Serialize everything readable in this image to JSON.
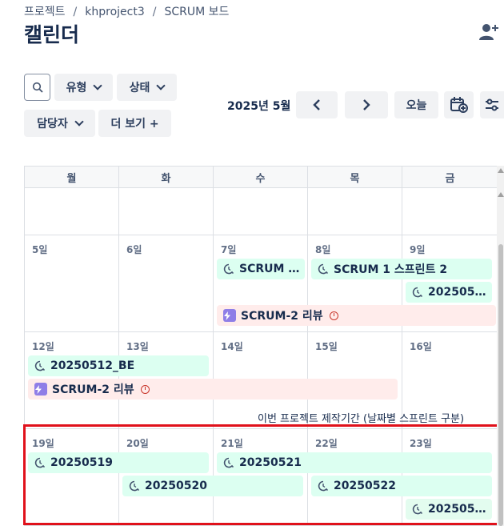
{
  "breadcrumb": {
    "items": [
      "프로젝트",
      "khproject3",
      "SCRUM 보드"
    ],
    "separator": "/"
  },
  "page": {
    "title": "캘린더"
  },
  "toolbar": {
    "filters": [
      "유형",
      "상태",
      "담당자"
    ],
    "more_label": "더 보기 +",
    "month_label": "2025년 5월",
    "today_label": "오늘"
  },
  "calendar": {
    "weekdays": [
      "월",
      "화",
      "수",
      "목",
      "금"
    ],
    "rows": [
      {
        "days": [
          "",
          "",
          "",
          "",
          ""
        ]
      },
      {
        "days": [
          "5일",
          "6일",
          "7일",
          "8일",
          "9일"
        ]
      },
      {
        "days": [
          "12일",
          "13일",
          "14일",
          "15일",
          "16일"
        ]
      },
      {
        "days": [
          "19일",
          "20일",
          "21일",
          "22일",
          "23일"
        ]
      }
    ],
    "events": {
      "e1": "SCRUM 1...",
      "e2": "SCRUM 1 스프린트 2",
      "e3": "2025050...",
      "e4": "SCRUM-2 리뷰",
      "e5": "20250512_BE",
      "e6": "SCRUM-2 리뷰",
      "e7": "20250519",
      "e8": "20250521",
      "e9": "20250520",
      "e10": "20250522",
      "e11": "2025052..."
    }
  },
  "annotation": {
    "note": "이번 프로젝트 제작기간 (날짜별 스프린트 구분)"
  },
  "colors": {
    "event_green": "#dcfff1",
    "event_red": "#ffeceb",
    "highlight_border": "#e0111b",
    "task_purple": "#8f7ee7"
  }
}
